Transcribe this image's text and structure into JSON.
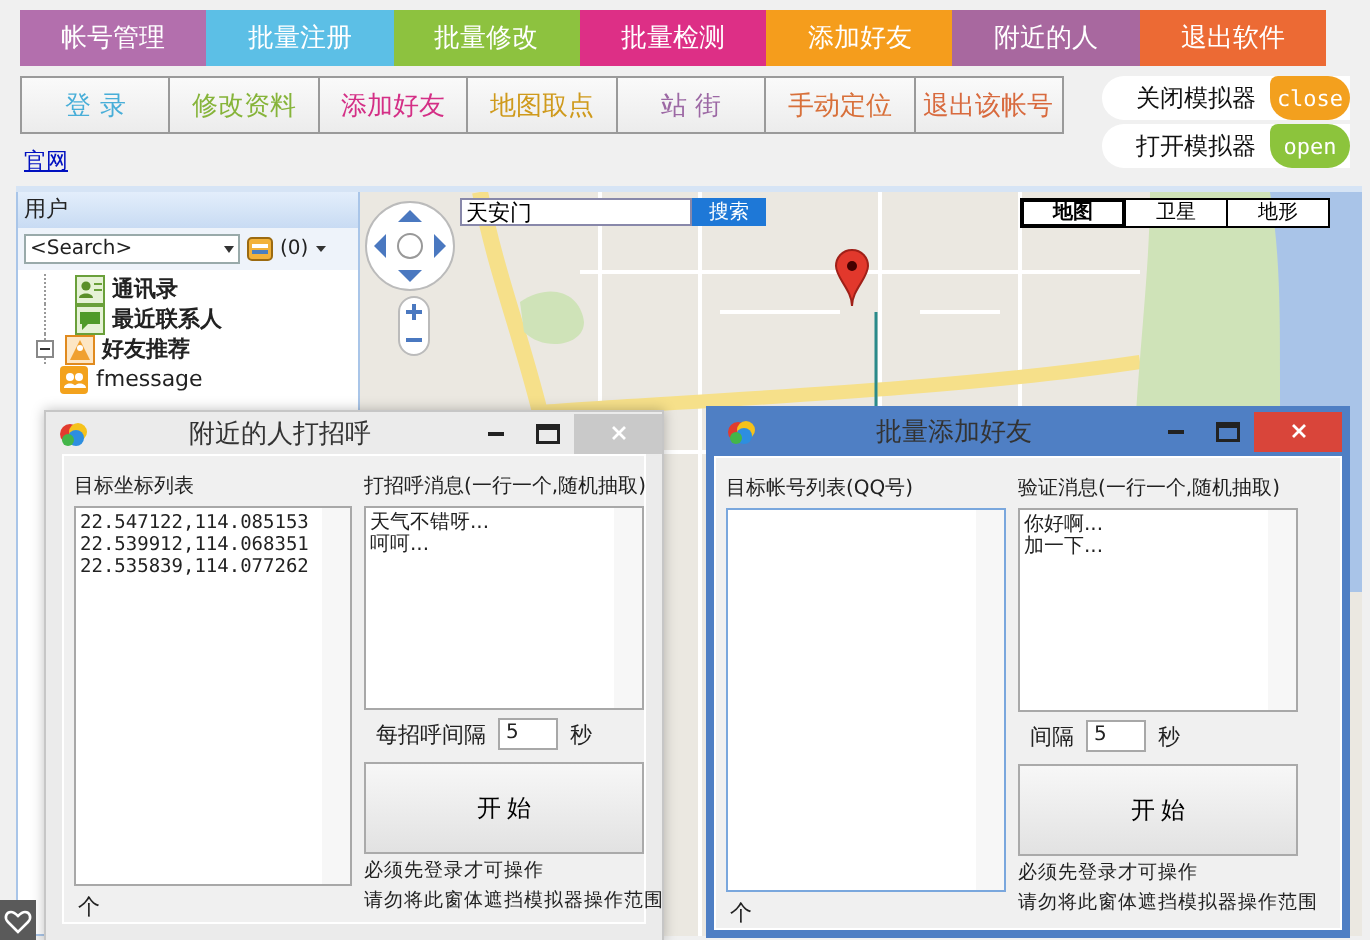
{
  "top_tabs": [
    {
      "label": "帐号管理",
      "color": "#b36fad"
    },
    {
      "label": "批量注册",
      "color": "#5cbfe6"
    },
    {
      "label": "批量修改",
      "color": "#8dc23f"
    },
    {
      "label": "批量检测",
      "color": "#dd2f86"
    },
    {
      "label": "添加好友",
      "color": "#f59d1c"
    },
    {
      "label": "附近的人",
      "color": "#a8689f"
    },
    {
      "label": "退出软件",
      "color": "#ec6a34"
    }
  ],
  "action_buttons": [
    {
      "label": "登 录",
      "color": "#48aed8"
    },
    {
      "label": "修改资料",
      "color": "#86b43a"
    },
    {
      "label": "添加好友",
      "color": "#d42f86"
    },
    {
      "label": "地图取点",
      "color": "#cf9a1c"
    },
    {
      "label": "站 街",
      "color": "#9c68a4"
    },
    {
      "label": "手动定位",
      "color": "#d8703a"
    },
    {
      "label": "退出该帐号",
      "color": "#d86a3e"
    }
  ],
  "simulator_toggles": [
    {
      "label": "关闭模拟器",
      "switch_text": "close",
      "color": "#f3a01e"
    },
    {
      "label": "打开模拟器",
      "switch_text": "open",
      "color": "#8cc43c"
    }
  ],
  "website_link": "官网",
  "user_panel": {
    "title": "用户",
    "search": {
      "value": "<Search>"
    },
    "message_count": "(0)",
    "tree": [
      {
        "kind": "contacts",
        "label": "通讯录"
      },
      {
        "kind": "recent",
        "label": "最近联系人"
      },
      {
        "kind": "recommend",
        "label": "好友推荐",
        "expanded": true,
        "children": [
          {
            "kind": "fmessage",
            "label": "fmessage"
          }
        ]
      }
    ]
  },
  "map": {
    "search": {
      "value": "天安门"
    },
    "search_button": "搜索",
    "map_types": [
      {
        "label": "地图",
        "selected": true
      },
      {
        "label": "卫星",
        "selected": false
      },
      {
        "label": "地形",
        "selected": false
      }
    ]
  },
  "dialogs": [
    {
      "title": "附近的人打招呼",
      "active": false,
      "list_label": "目标坐标列表",
      "list_lines": [
        "22.547122,114.085153",
        "22.539912,114.068351",
        "22.535839,114.077262"
      ],
      "count_label": "个",
      "message_label": "打招呼消息(一行一个,随机抽取)",
      "message_lines": [
        "天气不错呀...",
        "呵呵..."
      ],
      "interval_label": "每招呼间隔",
      "interval_value": "5",
      "interval_unit": "秒",
      "start_button": "开 始",
      "notes": [
        "必须先登录才可操作",
        "请勿将此窗体遮挡模拟器操作范围"
      ]
    },
    {
      "title": "批量添加好友",
      "active": true,
      "list_label": "目标帐号列表(QQ号)",
      "count_label": "个",
      "message_label": "验证消息(一行一个,随机抽取)",
      "message_lines": [
        "你好啊...",
        "加一下..."
      ],
      "interval_label": "间隔",
      "interval_value": "5",
      "interval_unit": "秒",
      "start_button": "开 始",
      "notes": [
        "必须先登录才可操作",
        "请勿将此窗体遮挡模拟器操作范围"
      ]
    }
  ]
}
